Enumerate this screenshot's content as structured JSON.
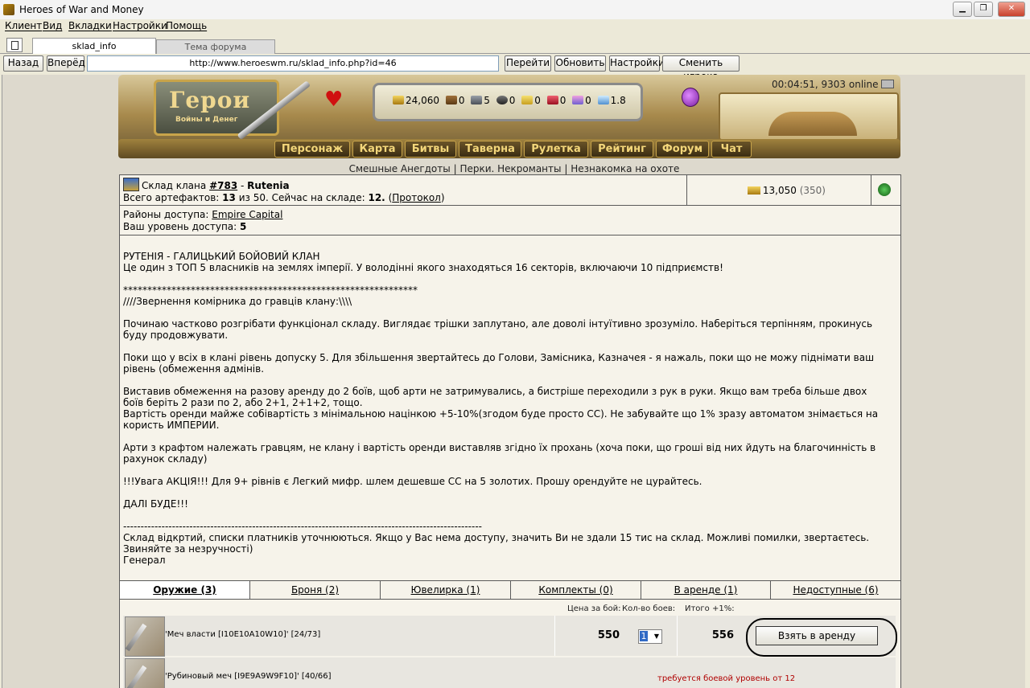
{
  "window": {
    "title": "Heroes of War and Money"
  },
  "menu": [
    "Клиент",
    "Вид",
    "Вкладки",
    "Настройки",
    "Помощь"
  ],
  "tabs": [
    {
      "label": "sklad_info"
    },
    {
      "label": "Тема форума"
    }
  ],
  "nav": {
    "back": "Назад",
    "forward": "Вперёд",
    "url": "http://www.heroeswm.ru/sklad_info.php?id=46",
    "go": "Перейти",
    "refresh": "Обновить",
    "settings": "Настройки",
    "switch_player": "Сменить игрока"
  },
  "header": {
    "logo_main": "Герои",
    "logo_sub": "Войны и Денег",
    "resources": [
      "24,060",
      "0",
      "5",
      "0",
      "0",
      "0",
      "0",
      "1.8"
    ],
    "resource_icons": [
      "gold-icon",
      "wood-icon",
      "ore-icon",
      "mercury-icon",
      "sulfur-icon",
      "crystal-icon",
      "gems-icon",
      "diamond-icon"
    ],
    "game_menu": [
      "Персонаж",
      "Карта",
      "Битвы",
      "Таверна",
      "Рулетка",
      "Рейтинг",
      "Форум",
      "Чат"
    ],
    "online": "00:04:51, 9303 online"
  },
  "news": {
    "item1": "Смешные Анегдоты",
    "item2": "Перки. Некроманты",
    "item3": "Незнакомка на охоте",
    "sep": "|"
  },
  "storage": {
    "label": "Склад клана",
    "clan_id": "#783",
    "dash": "-",
    "clan_name": "Rutenia",
    "total_label": "Всего артефактов:",
    "total": "13",
    "of": "из",
    "capacity": "50.",
    "now_label": "Сейчас на складе:",
    "now": "12.",
    "protocol": "Протокол",
    "gold": "13,050",
    "gold_extra": "(350)",
    "areas_label": "Районы доступа:",
    "area": "Empire Capital",
    "level_label": "Ваш уровень доступа:",
    "level": "5"
  },
  "description": "РУТЕНІЯ - ГАЛИЦЬКИЙ БОЙОВИЙ КЛАН\nЦе один з ТОП 5 власників на землях імперії. У володінні якого знаходяться 16 секторів, включаючи 10 підприємств!\n\n*************************************************************\n////Звернення комірника до гравців клану:\\\\\\\\\n\nПочинаю частково розгрібати функціонал складу. Виглядає трішки заплутано, але доволі інтуїтивно зрозуміло. Наберіться терпінням, прокинусь\nбуду продовжувати.\n\nПоки що у всіх в клані рівень допуску 5. Для збільшення звертайтесь до Голови, Замісника, Казначея - я нажаль, поки що не можу піднімати ваш\nрівень (обмеження адмінів.\n\nВиставив обмеження на разову аренду до 2 боїв, щоб арти не затримувались, а бистріше переходили з рук в руки. Якщо вам треба більше двох\nбоїв беріть 2 рази по 2, або 2+1, 2+1+2, тощо.\nВартість оренди майже собівартість з мінімальною націнкою +5-10%(згодом буде просто СС). Не забувайте що 1% зразу автоматом знімається на\nкористь ИМПЕРИИ.\n\nАрти з крафтом належать гравцям, не клану і вартість оренди виставляв згідно їх прохань (хоча поки, що гроші від них йдуть на благочинність в\nрахунок складу)\n\n!!!Увага АКЦІЯ!!! Для 9+ рівнів є Легкий мифр. шлем дешевше СС на 5 золотих. Прошу орендуйте не цурайтесь.\n\nДАЛІ БУДЕ!!!\n\n-------------------------------------------------------------------------------------------------------\nСклад відкртий, списки платників уточнюються. Якщо у Вас нема доступу, значить Ви не здали 15 тис на склад. Можливі помилки, звертаєтесь.\nЗвиняйте за незручності)\nГенерал",
  "categories": [
    {
      "label": "Оружие (3)"
    },
    {
      "label": "Броня (2)"
    },
    {
      "label": "Ювелирка (1)"
    },
    {
      "label": "Комплекты (0)"
    },
    {
      "label": "В аренде (1)"
    },
    {
      "label": "Недоступные (6)"
    }
  ],
  "columns": {
    "price_per_battle": "Цена за бой:",
    "battles": "Кол-во боев:",
    "total": "Итого +1%:"
  },
  "items": [
    {
      "name": "'Меч власти [I10E10A10W10]' [24/73]",
      "price": "550",
      "qty": "1",
      "total": "556",
      "action": "Взять в аренду"
    },
    {
      "name": "'Рубиновый меч [I9E9A9W9F10]' [40/66]",
      "requirement": "требуется боевой уровень от 12"
    }
  ]
}
